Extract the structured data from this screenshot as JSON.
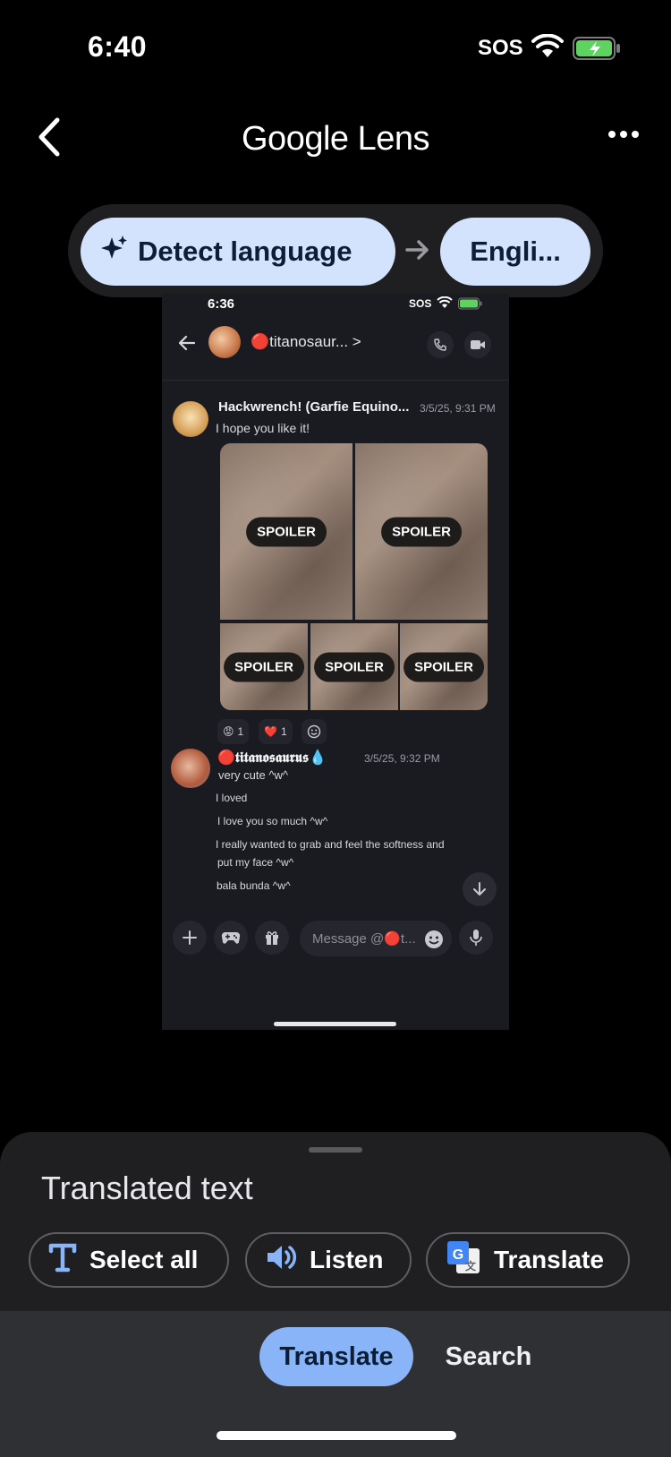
{
  "status_bar": {
    "time": "6:40",
    "carrier": "SOS"
  },
  "header": {
    "title": "Google Lens"
  },
  "language_bar": {
    "source": "Detect language",
    "target": "Engli..."
  },
  "screenshot": {
    "status": {
      "time": "6:36",
      "carrier": "SOS"
    },
    "chat_title": "🔴titanosaur... >",
    "messages": [
      {
        "author": "Hackwrench! (Garfie Equino...",
        "time": "3/5/25, 9:31 PM",
        "text": "I hope you like it!",
        "spoilers": [
          "SPOILER",
          "SPOILER",
          "SPOILER",
          "SPOILER",
          "SPOILER"
        ],
        "reactions": [
          {
            "emoji": "😡",
            "count": "1"
          },
          {
            "emoji": "❤️",
            "count": "1"
          }
        ]
      },
      {
        "author": "🔴𝖙𝖎𝖙𝖆𝖓𝖔𝖘𝖆𝖚𝖗𝖚𝖘💧",
        "time": "3/5/25, 9:32 PM",
        "lines": [
          "very cute ^w^",
          "I loved",
          "I love you so much ^w^",
          "I really wanted to grab and feel the softness and",
          "put my face ^w^",
          "bala bunda ^w^"
        ]
      }
    ],
    "input_placeholder": "Message @🔴t..."
  },
  "sheet": {
    "title": "Translated text",
    "chips": {
      "select_all": "Select all",
      "listen": "Listen",
      "translate": "Translate"
    }
  },
  "nav": {
    "translate": "Translate",
    "search": "Search"
  },
  "colors": {
    "pill": "#d3e3fd",
    "nav_active": "#8ab4f8",
    "sheet": "#1f1f22"
  }
}
